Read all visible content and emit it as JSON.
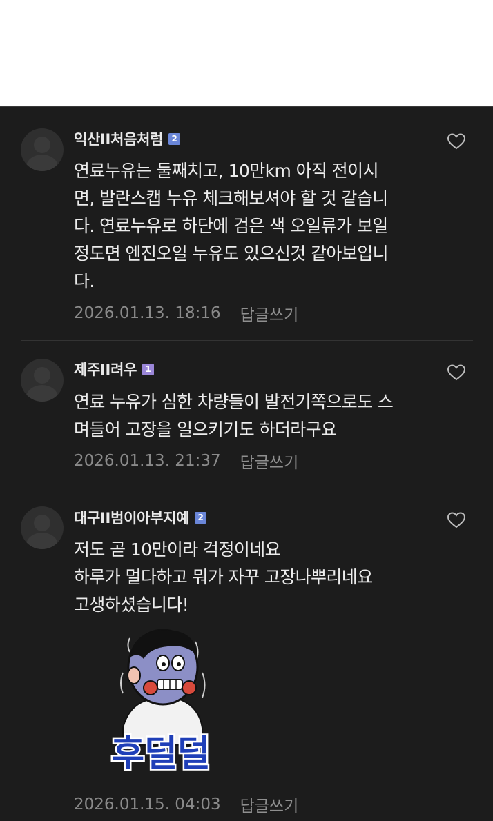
{
  "comments": [
    {
      "author": "익산II처음처럼",
      "level": "2",
      "text": "연료누유는 둘째치고, 10만km 아직 전이시\n면, 발란스캡 누유 체크해보셔야 할 것 같습니\n다. 연료누유로 하단에 검은 색 오일류가 보일\n정도면 엔진오일 누유도 있으신것 같아보입니\n다.",
      "date": "2026.01.13. 18:16",
      "reply_label": "답글쓰기"
    },
    {
      "author": "제주II려우",
      "level": "1",
      "text": "연료 누유가 심한 차량들이 발전기쪽으로도 스\n며들어 고장을 일으키기도 하더라구요",
      "date": "2026.01.13. 21:37",
      "reply_label": "답글쓰기"
    },
    {
      "author": "대구II범이아부지예",
      "level": "2",
      "text": "저도 곧 10만이라 걱정이네요\n하루가 멀다하고 뭐가 자꾸 고장나뿌리네요\n고생하셨습니다!",
      "date": "2026.01.15. 04:03",
      "reply_label": "답글쓰기",
      "sticker_text": "후덜덜"
    }
  ],
  "icons": {
    "like": "heart-outline-icon",
    "avatar": "default-profile-icon"
  },
  "colors": {
    "background": "#1c1c1c",
    "level2_badge": "#6a86d8",
    "level1_badge": "#9a86d8",
    "sticker_text": "#1f3fb8"
  }
}
